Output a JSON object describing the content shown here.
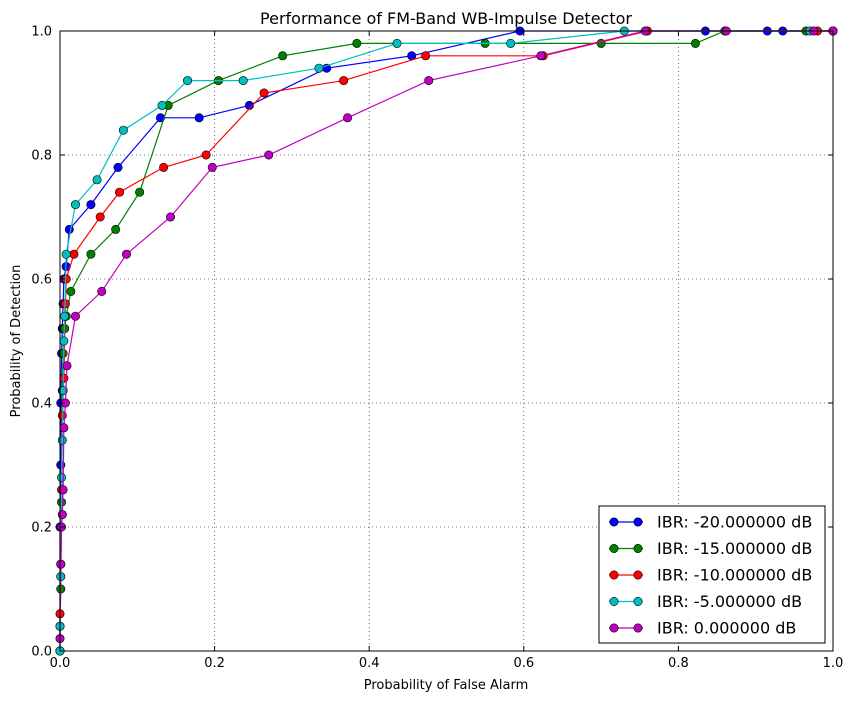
{
  "chart_data": {
    "type": "line",
    "title": "Performance of FM-Band WB-Impulse Detector",
    "xlabel": "Probability of False Alarm",
    "ylabel": "Probability of Detection",
    "xlim": [
      0,
      1
    ],
    "ylim": [
      0,
      1
    ],
    "xticks": [
      "0.0",
      "0.2",
      "0.4",
      "0.6",
      "0.8",
      "1.0"
    ],
    "yticks": [
      "0.0",
      "0.2",
      "0.4",
      "0.6",
      "0.8",
      "1.0"
    ],
    "grid": true,
    "legend_position": "lower-right",
    "marker": "circle",
    "series": [
      {
        "name": "IBR: -20.000000 dB",
        "color": "#0000ff",
        "x": [
          0,
          0,
          0.001,
          0.001,
          0.002,
          0.003,
          0.004,
          0.005,
          0.008,
          0.012,
          0.04,
          0.075,
          0.13,
          0.18,
          0.245,
          0.345,
          0.455,
          0.595,
          0.835,
          0.915,
          0.935,
          1.0
        ],
        "y": [
          0,
          0.2,
          0.3,
          0.4,
          0.48,
          0.52,
          0.56,
          0.6,
          0.62,
          0.68,
          0.72,
          0.78,
          0.86,
          0.86,
          0.88,
          0.94,
          0.96,
          1.0,
          1.0,
          1.0,
          1.0,
          1.0
        ]
      },
      {
        "name": "IBR: -15.000000 dB",
        "color": "#008000",
        "x": [
          0,
          0,
          0.001,
          0.002,
          0.003,
          0.004,
          0.006,
          0.008,
          0.014,
          0.04,
          0.072,
          0.103,
          0.14,
          0.205,
          0.288,
          0.384,
          0.55,
          0.7,
          0.822,
          0.86,
          0.965,
          1.0
        ],
        "y": [
          0,
          0.04,
          0.1,
          0.24,
          0.42,
          0.48,
          0.52,
          0.54,
          0.58,
          0.64,
          0.68,
          0.74,
          0.88,
          0.92,
          0.96,
          0.98,
          0.98,
          0.98,
          0.98,
          1.0,
          1.0,
          1.0
        ]
      },
      {
        "name": "IBR: -10.000000 dB",
        "color": "#ff0000",
        "x": [
          0,
          0,
          0.001,
          0.002,
          0.003,
          0.005,
          0.007,
          0.008,
          0.018,
          0.052,
          0.077,
          0.134,
          0.189,
          0.264,
          0.367,
          0.473,
          0.625,
          0.76,
          0.98,
          1.0
        ],
        "y": [
          0,
          0.06,
          0.14,
          0.26,
          0.38,
          0.44,
          0.56,
          0.6,
          0.64,
          0.7,
          0.74,
          0.78,
          0.8,
          0.9,
          0.92,
          0.96,
          0.96,
          1.0,
          1.0,
          1.0
        ]
      },
      {
        "name": "IBR: -5.000000 dB",
        "color": "#00bfbf",
        "x": [
          0,
          0,
          0.001,
          0.002,
          0.003,
          0.004,
          0.005,
          0.006,
          0.008,
          0.02,
          0.048,
          0.082,
          0.132,
          0.165,
          0.237,
          0.335,
          0.436,
          0.583,
          0.73,
          0.97,
          1.0
        ],
        "y": [
          0,
          0.04,
          0.12,
          0.28,
          0.34,
          0.42,
          0.5,
          0.54,
          0.64,
          0.72,
          0.76,
          0.84,
          0.88,
          0.92,
          0.92,
          0.94,
          0.98,
          0.98,
          1.0,
          1.0,
          1.0
        ]
      },
      {
        "name": "IBR: 0.000000 dB",
        "color": "#bf00bf",
        "x": [
          0,
          0.001,
          0.002,
          0.003,
          0.004,
          0.005,
          0.007,
          0.009,
          0.02,
          0.054,
          0.086,
          0.143,
          0.197,
          0.27,
          0.372,
          0.477,
          0.622,
          0.757,
          0.862,
          0.975,
          1.0
        ],
        "y": [
          0.02,
          0.14,
          0.2,
          0.22,
          0.26,
          0.36,
          0.4,
          0.46,
          0.54,
          0.58,
          0.64,
          0.7,
          0.78,
          0.8,
          0.86,
          0.92,
          0.96,
          1.0,
          1.0,
          1.0,
          1.0
        ]
      }
    ]
  }
}
